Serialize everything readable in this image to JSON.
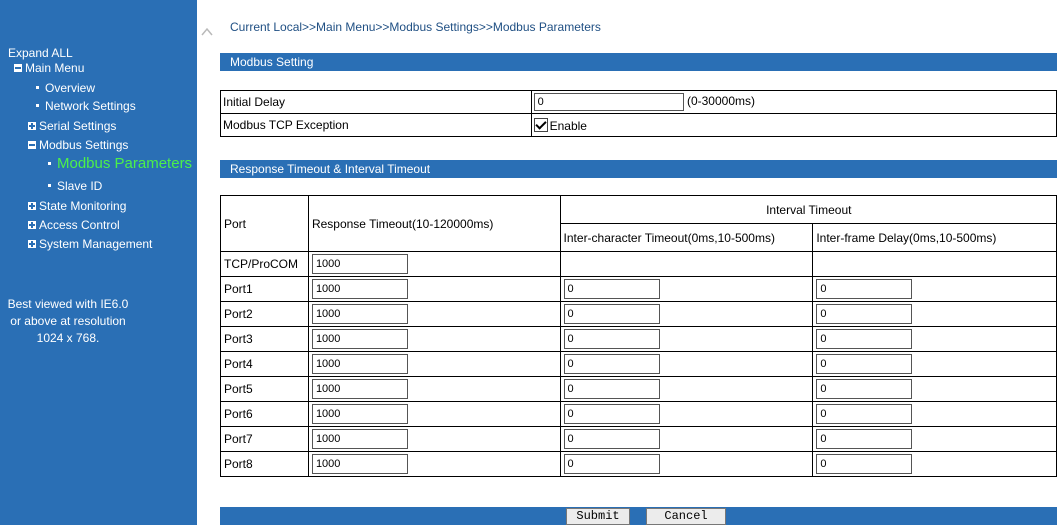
{
  "breadcrumb": "Current Local>>Main Menu>>Modbus Settings>>Modbus Parameters",
  "sidebar": {
    "expand_all": "Expand ALL",
    "main_menu": "Main Menu",
    "overview": "Overview",
    "network_settings": "Network Settings",
    "serial_settings": "Serial Settings",
    "modbus_settings": "Modbus Settings",
    "modbus_parameters": "Modbus Parameters",
    "slave_id": "Slave ID",
    "state_monitoring": "State Monitoring",
    "access_control": "Access Control",
    "system_management": "System Management",
    "best_line1": "Best viewed with IE6.0",
    "best_line2": "or above at resolution",
    "best_line3": "1024 x 768."
  },
  "modbus_setting": {
    "header": "Modbus Setting",
    "initial_delay_label": "Initial Delay",
    "initial_delay_value": "0",
    "initial_delay_range": "(0-30000ms)",
    "tcp_exception_label": "Modbus TCP Exception",
    "enable_label": "Enable"
  },
  "timeout": {
    "header": "Response Timeout & Interval Timeout",
    "port_col": "Port",
    "response_col": "Response Timeout(10-120000ms)",
    "interval_col": "Interval Timeout",
    "inter_char_col": "Inter-character Timeout(0ms,10-500ms)",
    "inter_frame_col": "Inter-frame Delay(0ms,10-500ms)",
    "tcp_row": {
      "port": "TCP/ProCOM",
      "response": "1000"
    },
    "rows": [
      {
        "port": "Port1",
        "response": "1000",
        "inter_char": "0",
        "inter_frame": "0"
      },
      {
        "port": "Port2",
        "response": "1000",
        "inter_char": "0",
        "inter_frame": "0"
      },
      {
        "port": "Port3",
        "response": "1000",
        "inter_char": "0",
        "inter_frame": "0"
      },
      {
        "port": "Port4",
        "response": "1000",
        "inter_char": "0",
        "inter_frame": "0"
      },
      {
        "port": "Port5",
        "response": "1000",
        "inter_char": "0",
        "inter_frame": "0"
      },
      {
        "port": "Port6",
        "response": "1000",
        "inter_char": "0",
        "inter_frame": "0"
      },
      {
        "port": "Port7",
        "response": "1000",
        "inter_char": "0",
        "inter_frame": "0"
      },
      {
        "port": "Port8",
        "response": "1000",
        "inter_char": "0",
        "inter_frame": "0"
      }
    ]
  },
  "buttons": {
    "submit": "Submit",
    "cancel": "Cancel"
  },
  "colors": {
    "accent": "#2a6fb5",
    "active_menu": "#4cf04a",
    "breadcrumb": "#1f4f83"
  }
}
